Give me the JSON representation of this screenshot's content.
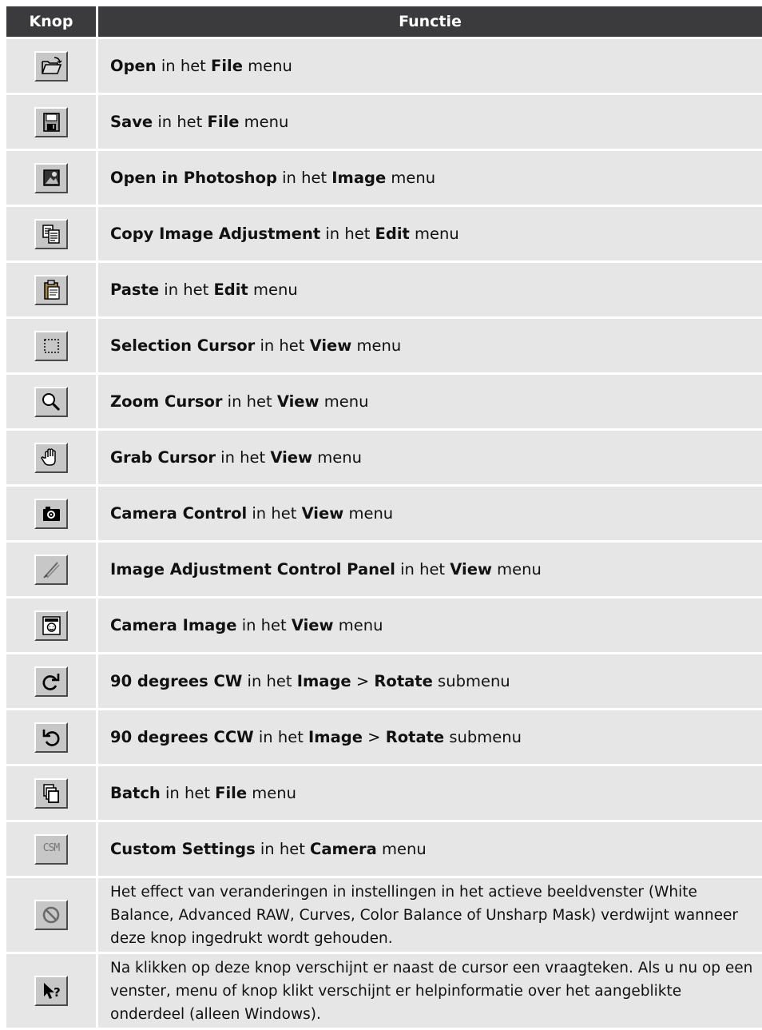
{
  "header": {
    "col_button": "Knop",
    "col_function": "Functie"
  },
  "rows": [
    {
      "icon": "open-folder-icon",
      "parts": [
        {
          "t": "Open",
          "b": true
        },
        {
          "t": " in het "
        },
        {
          "t": "File",
          "b": true
        },
        {
          "t": " menu"
        }
      ]
    },
    {
      "icon": "save-disk-icon",
      "parts": [
        {
          "t": "Save",
          "b": true
        },
        {
          "t": " in het "
        },
        {
          "t": "File",
          "b": true
        },
        {
          "t": " menu"
        }
      ]
    },
    {
      "icon": "photoshop-icon",
      "parts": [
        {
          "t": "Open in Photoshop",
          "b": true
        },
        {
          "t": " in het "
        },
        {
          "t": "Image",
          "b": true
        },
        {
          "t": " menu"
        }
      ]
    },
    {
      "icon": "copy-icon",
      "parts": [
        {
          "t": "Copy Image Adjustment",
          "b": true
        },
        {
          "t": " in het "
        },
        {
          "t": "Edit",
          "b": true
        },
        {
          "t": " menu"
        }
      ]
    },
    {
      "icon": "paste-icon",
      "parts": [
        {
          "t": "Paste",
          "b": true
        },
        {
          "t": " in het "
        },
        {
          "t": "Edit",
          "b": true
        },
        {
          "t": " menu"
        }
      ]
    },
    {
      "icon": "selection-marquee-icon",
      "parts": [
        {
          "t": "Selection Cursor",
          "b": true
        },
        {
          "t": " in het "
        },
        {
          "t": "View",
          "b": true
        },
        {
          "t": " menu"
        }
      ]
    },
    {
      "icon": "magnifier-icon",
      "parts": [
        {
          "t": "Zoom Cursor",
          "b": true
        },
        {
          "t": " in het "
        },
        {
          "t": "View",
          "b": true
        },
        {
          "t": " menu"
        }
      ]
    },
    {
      "icon": "hand-icon",
      "parts": [
        {
          "t": "Grab Cursor",
          "b": true
        },
        {
          "t": " in het "
        },
        {
          "t": "View",
          "b": true
        },
        {
          "t": " menu"
        }
      ]
    },
    {
      "icon": "camera-icon",
      "parts": [
        {
          "t": "Camera Control",
          "b": true
        },
        {
          "t": " in het "
        },
        {
          "t": "View",
          "b": true
        },
        {
          "t": " menu"
        }
      ]
    },
    {
      "icon": "adjustment-pen-icon",
      "parts": [
        {
          "t": "Image Adjustment Control Panel",
          "b": true
        },
        {
          "t": " in het "
        },
        {
          "t": "View",
          "b": true
        },
        {
          "t": " menu"
        }
      ]
    },
    {
      "icon": "camera-image-icon",
      "parts": [
        {
          "t": "Camera Image",
          "b": true
        },
        {
          "t": " in het "
        },
        {
          "t": "View",
          "b": true
        },
        {
          "t": " menu"
        }
      ]
    },
    {
      "icon": "rotate-cw-icon",
      "parts": [
        {
          "t": "90 degrees CW",
          "b": true
        },
        {
          "t": " in het "
        },
        {
          "t": "Image",
          "b": true
        },
        {
          "t": " > "
        },
        {
          "t": "Rotate",
          "b": true
        },
        {
          "t": " submenu"
        }
      ]
    },
    {
      "icon": "rotate-ccw-icon",
      "parts": [
        {
          "t": "90 degrees CCW",
          "b": true
        },
        {
          "t": " in het "
        },
        {
          "t": "Image",
          "b": true
        },
        {
          "t": " > "
        },
        {
          "t": "Rotate",
          "b": true
        },
        {
          "t": " submenu"
        }
      ]
    },
    {
      "icon": "batch-icon",
      "parts": [
        {
          "t": "Batch",
          "b": true
        },
        {
          "t": " in het "
        },
        {
          "t": "File",
          "b": true
        },
        {
          "t": " menu"
        }
      ]
    },
    {
      "icon": "csm-icon",
      "icon_text": "CSM",
      "parts": [
        {
          "t": "Custom Settings",
          "b": true
        },
        {
          "t": " in het "
        },
        {
          "t": "Camera",
          "b": true
        },
        {
          "t": " menu"
        }
      ]
    },
    {
      "icon": "no-effect-icon",
      "long": true,
      "parts": [
        {
          "t": "Het effect van veranderingen in instellingen in het actieve beeldvenster (White Balance, Advanced RAW, Curves, Color Balance of Unsharp Mask) verdwijnt wanneer deze knop ingedrukt wordt gehouden."
        }
      ]
    },
    {
      "icon": "help-arrow-icon",
      "long": true,
      "parts": [
        {
          "t": "Na klikken op deze knop verschijnt er naast de cursor een vraagteken. Als u nu op een venster, menu of knop klikt verschijnt er helpinformatie over het aangeblikte onderdeel (alleen Windows)."
        }
      ]
    }
  ]
}
